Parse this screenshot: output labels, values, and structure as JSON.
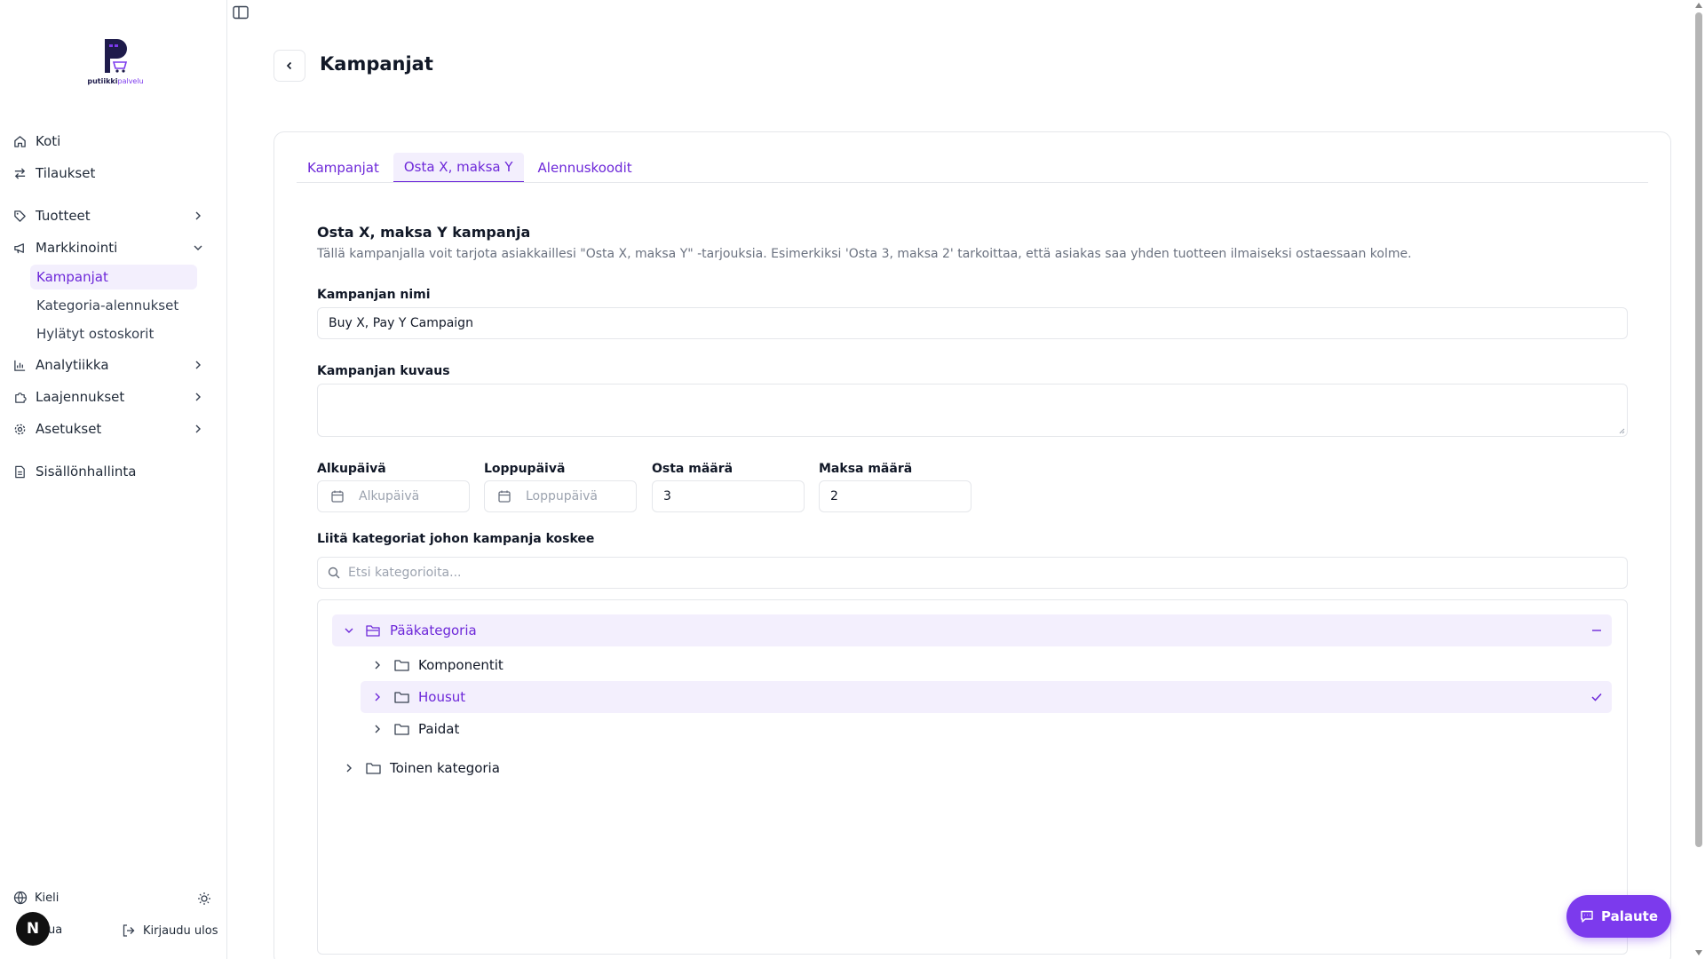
{
  "brand": {
    "logo_text_a": "putiikki",
    "logo_text_b": "palvelu"
  },
  "sidebar": {
    "items": [
      {
        "label": "Koti",
        "icon": "home-icon"
      },
      {
        "label": "Tilaukset",
        "icon": "arrows-icon"
      },
      {
        "label": "Tuotteet",
        "icon": "tag-icon"
      },
      {
        "label": "Markkinointi",
        "icon": "megaphone-icon"
      },
      {
        "label": "Analytiikka",
        "icon": "chart-icon"
      },
      {
        "label": "Laajennukset",
        "icon": "puzzle-icon"
      },
      {
        "label": "Asetukset",
        "icon": "gear-icon"
      },
      {
        "label": "Sisällönhallinta",
        "icon": "document-icon"
      }
    ],
    "marketing_sub": [
      {
        "label": "Kampanjat",
        "active": true
      },
      {
        "label": "Kategoria-alennukset",
        "active": false
      },
      {
        "label": "Hylätyt ostoskorit",
        "active": false
      }
    ],
    "footer": {
      "language": "Kieli",
      "theme_partial": "ua",
      "logout": "Kirjaudu ulos",
      "avatar_letter": "N"
    }
  },
  "header": {
    "title": "Kampanjat"
  },
  "tabs": [
    {
      "label": "Kampanjat",
      "active": false
    },
    {
      "label": "Osta X, maksa Y",
      "active": true
    },
    {
      "label": "Alennuskoodit",
      "active": false
    }
  ],
  "form": {
    "section_title": "Osta X, maksa Y kampanja",
    "section_desc": "Tällä kampanjalla voit tarjota asiakkaillesi \"Osta X, maksa Y\" -tarjouksia. Esimerkiksi 'Osta 3, maksa 2' tarkoittaa, että asiakas saa yhden tuotteen ilmaiseksi ostaessaan kolme.",
    "name_label": "Kampanjan nimi",
    "name_value": "Buy X, Pay Y Campaign",
    "desc_label": "Kampanjan kuvaus",
    "desc_value": "",
    "start_label": "Alkupäivä",
    "start_placeholder": "Alkupäivä",
    "end_label": "Loppupäivä",
    "end_placeholder": "Loppupäivä",
    "buy_label": "Osta määrä",
    "buy_value": "3",
    "pay_label": "Maksa määrä",
    "pay_value": "2",
    "categories_label": "Liitä kategoriat johon kampanja koskee",
    "categories_search_placeholder": "Etsi kategorioita..."
  },
  "categories": {
    "root": {
      "label": "Pääkategoria",
      "expanded": true,
      "state": "partial"
    },
    "children": [
      {
        "label": "Komponentit",
        "selected": false
      },
      {
        "label": "Housut",
        "selected": true
      },
      {
        "label": "Paidat",
        "selected": false
      }
    ],
    "second_root": {
      "label": "Toinen kategoria",
      "expanded": false
    }
  },
  "feedback": {
    "label": "Palaute"
  },
  "colors": {
    "accent": "#7c3aed",
    "accent_soft": "#f3effd",
    "border": "#e5e7eb"
  }
}
